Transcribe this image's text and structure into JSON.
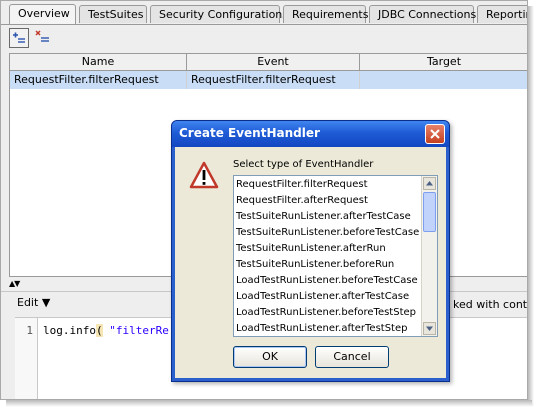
{
  "tabs": [
    "Overview",
    "TestSuites",
    "Security Configurations",
    "Requirements",
    "JDBC Connections",
    "Reportin"
  ],
  "toolbar": {
    "add_icon": "add-event-handler-icon",
    "remove_icon": "remove-event-handler-icon"
  },
  "table": {
    "columns": [
      "Name",
      "Event",
      "Target"
    ],
    "rows": [
      {
        "name": "RequestFilter.filterRequest",
        "event": "RequestFilter.filterRequest",
        "target": ""
      }
    ]
  },
  "editor": {
    "menu_label": "Edit",
    "truncated_text": "ked with conte",
    "line_number": "1",
    "code_prefix": "log.info",
    "code_paren": "(",
    "code_string": " \"filterRe"
  },
  "dialog": {
    "title": "Create EventHandler",
    "prompt": "Select type of EventHandler",
    "items": [
      "RequestFilter.filterRequest",
      "RequestFilter.afterRequest",
      "TestSuiteRunListener.afterTestCase",
      "TestSuiteRunListener.beforeTestCase",
      "TestSuiteRunListener.afterRun",
      "TestSuiteRunListener.beforeRun",
      "LoadTestRunListener.beforeTestCase",
      "LoadTestRunListener.afterTestCase",
      "LoadTestRunListener.beforeTestStep",
      "LoadTestRunListener.afterTestStep"
    ],
    "ok_label": "OK",
    "cancel_label": "Cancel"
  },
  "colors": {
    "selection": "#c9ddf6",
    "title_bar": "#1f5bd6",
    "dialog_face": "#ece9d8"
  }
}
